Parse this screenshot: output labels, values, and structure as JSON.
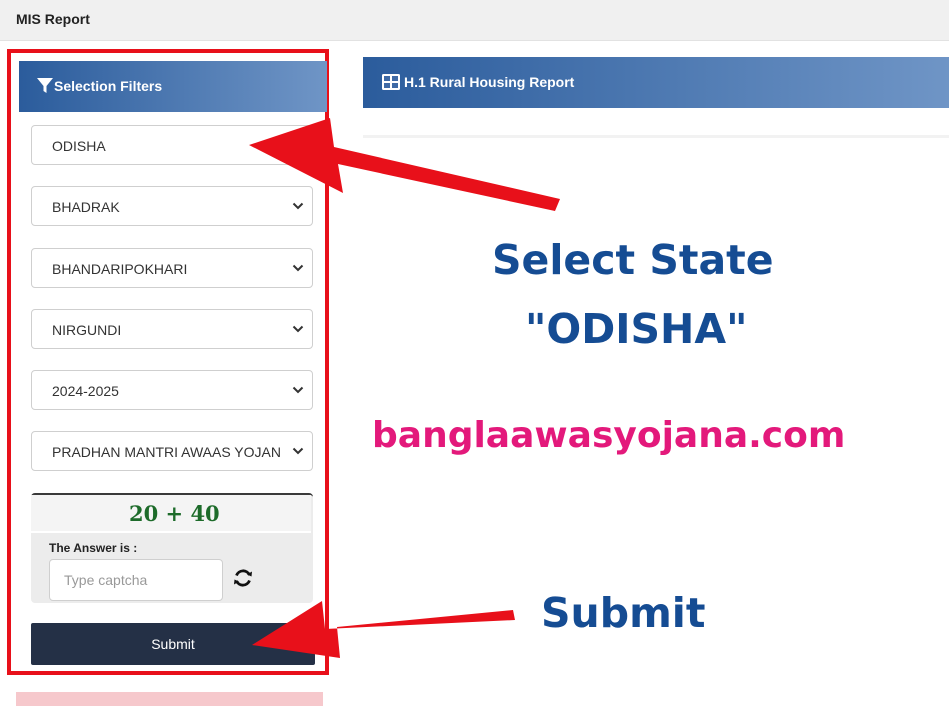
{
  "topbar": {
    "title": "MIS Report"
  },
  "filters": {
    "header": "Selection Filters",
    "header_icon": "filter-icon",
    "state": "ODISHA",
    "district": "BHADRAK",
    "block": "BHANDARIPOKHARI",
    "panchayat": "NIRGUNDI",
    "year": "2024-2025",
    "scheme": "PRADHAN MANTRI AWAAS YOJANA",
    "captcha_expression": "20 + 40",
    "answer_label": "The Answer is :",
    "captcha_placeholder": "Type captcha",
    "refresh_icon": "refresh-icon",
    "submit_label": "Submit"
  },
  "report": {
    "header": "H.1 Rural Housing Report",
    "header_icon": "table-icon"
  },
  "annotations": {
    "state_line1": "Select State",
    "state_line2": "\"ODISHA\"",
    "website": "banglaawasyojana.com",
    "submit": "Submit",
    "arrow_color": "#e8101a",
    "highlight_color": "#e8101a"
  },
  "colors": {
    "header_gradient_start": "#2b5c9c",
    "header_gradient_end": "#6f95c6",
    "submit_bg": "#243046",
    "annotation_blue": "#154c93",
    "annotation_pink": "#e3197b"
  }
}
